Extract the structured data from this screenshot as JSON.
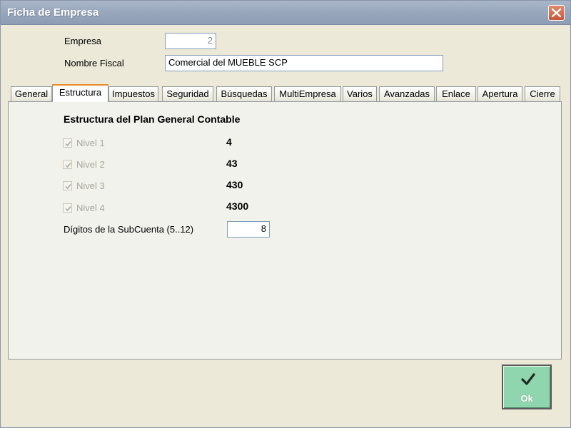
{
  "window": {
    "title": "Ficha de Empresa"
  },
  "header": {
    "empresa_label": "Empresa",
    "empresa_value": "2",
    "nombre_fiscal_label": "Nombre Fiscal",
    "nombre_fiscal_value": "Comercial del MUEBLE SCP"
  },
  "tabs": [
    {
      "label": "General"
    },
    {
      "label": "Estructura",
      "active": true
    },
    {
      "label": "Impuestos"
    },
    {
      "label": "Seguridad"
    },
    {
      "label": "Búsquedas"
    },
    {
      "label": "MultiEmpresa"
    },
    {
      "label": "Varios"
    },
    {
      "label": "Avanzadas"
    },
    {
      "label": "Enlace"
    },
    {
      "label": "Apertura"
    },
    {
      "label": "Cierre"
    }
  ],
  "estructura": {
    "title": "Estructura del Plan General Contable",
    "levels": [
      {
        "label": "Nivel 1",
        "checked": true,
        "value": "4"
      },
      {
        "label": "Nivel 2",
        "checked": true,
        "value": "43"
      },
      {
        "label": "Nivel 3",
        "checked": true,
        "value": "430"
      },
      {
        "label": "Nivel 4",
        "checked": true,
        "value": "4300"
      }
    ],
    "subcuenta_label": "Dígitos de la SubCuenta  (5..12)",
    "subcuenta_value": "8"
  },
  "ok_button": {
    "label": "Ok"
  },
  "colors": {
    "ok_bg": "#8fd5ad",
    "active_tab_accent": "#e68b2c",
    "close_bg": "#c9553a"
  }
}
